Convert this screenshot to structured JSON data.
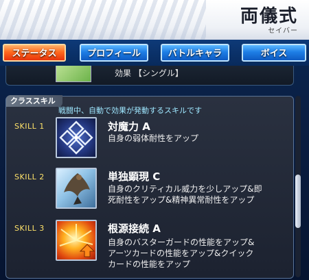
{
  "header": {
    "name": "両儀式",
    "class": "セイバー"
  },
  "tabs": [
    {
      "label": "ステータス",
      "active": true
    },
    {
      "label": "プロフィール",
      "active": false
    },
    {
      "label": "バトルキャラ",
      "active": false
    },
    {
      "label": "ボイス",
      "active": false
    }
  ],
  "prev_row": {
    "text": "効果 【シングル】"
  },
  "class_skills": {
    "tag": "クラススキル",
    "description": "戦闘中、自動で効果が発動するスキルです",
    "skills": [
      {
        "label": "SKILL 1",
        "name": "対魔力 A",
        "icon": "diamond-shield-icon",
        "lines": [
          "自身の弱体耐性をアップ"
        ]
      },
      {
        "label": "SKILL 2",
        "name": "単独顕現 C",
        "icon": "cloaked-figure-icon",
        "lines": [
          "自身のクリティカル威力を少しアップ&即",
          "死耐性をアップ&精神異常耐性をアップ"
        ]
      },
      {
        "label": "SKILL 3",
        "name": "根源接続 A",
        "icon": "burst-up-arrow-icon",
        "lines": [
          "自身のバスターガードの性能をアップ&",
          "アーツカードの性能をアップ&クイック",
          "カードの性能をアップ"
        ]
      }
    ]
  },
  "colors": {
    "active_tab": "#ff6a1e",
    "inactive_tab": "#1e7fe6",
    "skill_label": "#ffe36a",
    "description": "#9fe7ff"
  }
}
